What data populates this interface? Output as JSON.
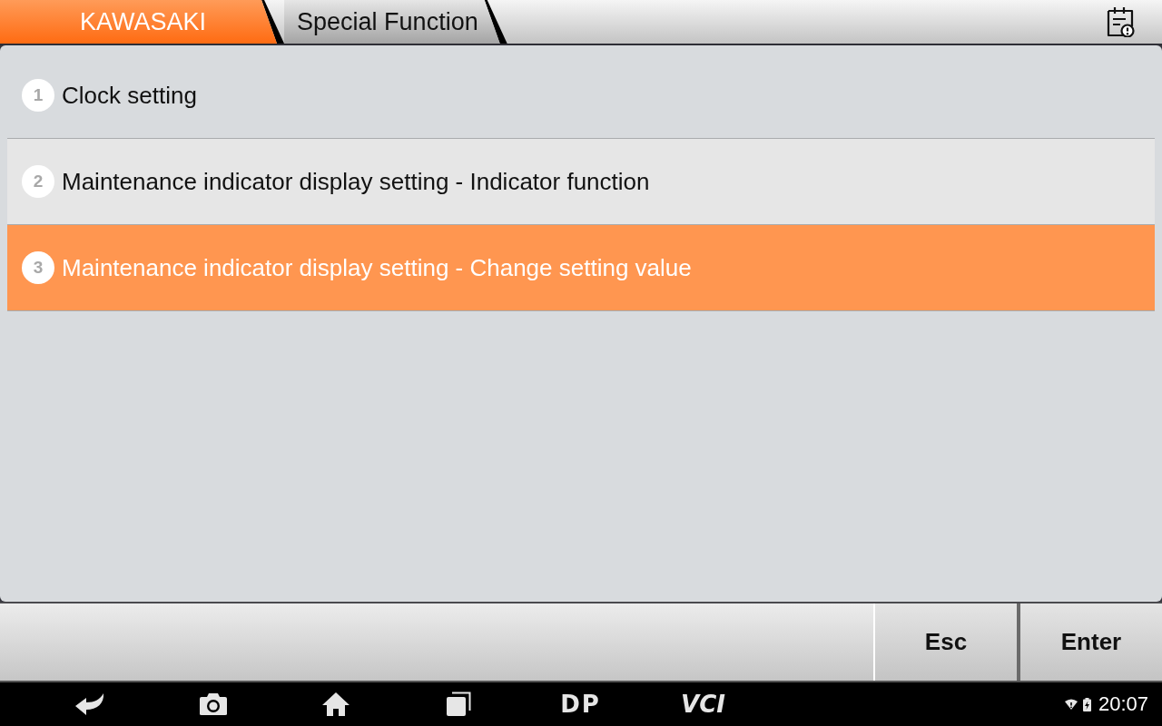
{
  "top_bar": {
    "breadcrumb": [
      {
        "label": "KAWASAKI",
        "selected": true
      },
      {
        "label": "Special Function",
        "selected": false
      }
    ]
  },
  "menu": {
    "items": [
      {
        "number": "1",
        "label": "Clock setting",
        "selected": false
      },
      {
        "number": "2",
        "label": "Maintenance indicator display setting - Indicator function",
        "selected": false
      },
      {
        "number": "3",
        "label": "Maintenance indicator display setting - Change setting value",
        "selected": true
      }
    ]
  },
  "action_bar": {
    "buttons": [
      "Esc",
      "Enter"
    ]
  },
  "nav_bar": {
    "labels": [
      "DP",
      "VCI"
    ]
  },
  "status_bar": {
    "time": "20:07"
  }
}
